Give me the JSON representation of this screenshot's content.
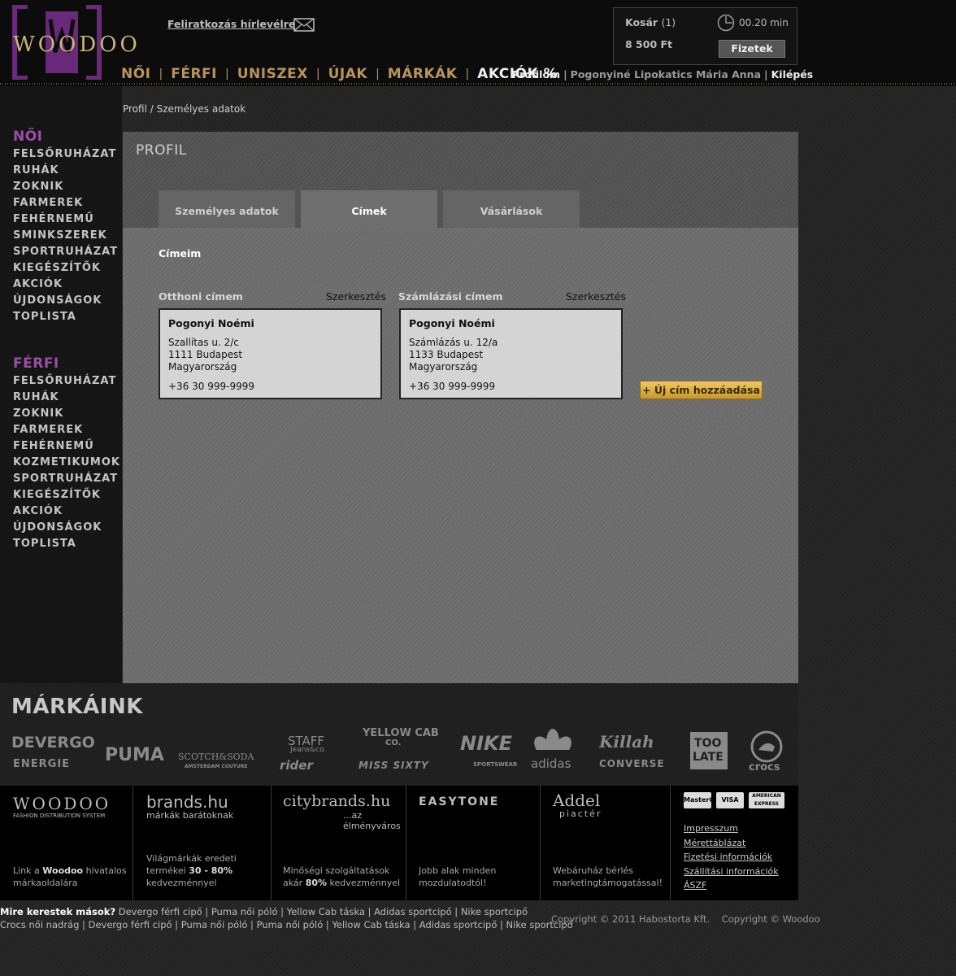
{
  "header": {
    "logo_text": "WOODOO",
    "newsletter": "Feliratkozás hírlevélre",
    "cart": {
      "title": "Kosár",
      "count": "(1)",
      "total": "8 500 Ft",
      "time": "00.20 min",
      "pay": "Fizetek"
    },
    "nav": [
      "NŐI",
      "FÉRFI",
      "UNISZEX",
      "ÚJAK",
      "MÁRKÁK",
      "AKCIÓK %"
    ],
    "user": {
      "profile": "Profilom",
      "name": "Pogonyiné Lipokatics Mária Anna",
      "logout": "Kilépés"
    }
  },
  "sidebar": {
    "women": {
      "title": "NŐI",
      "items": [
        "FELSŐRUHÁZAT",
        "RUHÁK",
        "ZOKNIK",
        "FARMEREK",
        "FEHÉRNEMŰ",
        "SMINKSZEREK",
        "SPORTRUHÁZAT",
        "KIEGÉSZÍTŐK",
        "AKCIÓK",
        "ÚJDONSÁGOK",
        "TOPLISTA"
      ]
    },
    "men": {
      "title": "FÉRFI",
      "items": [
        "FELSŐRUHÁZAT",
        "RUHÁK",
        "ZOKNIK",
        "FARMEREK",
        "FEHÉRNEMŰ",
        "KOZMETIKUMOK",
        "SPORTRUHÁZAT",
        "KIEGÉSZÍTŐK",
        "AKCIÓK",
        "ÚJDONSÁGOK",
        "TOPLISTA"
      ]
    }
  },
  "breadcrumb": "Profil / Személyes adatok",
  "profile": {
    "title": "PROFIL",
    "tabs": [
      "Személyes adatok",
      "Címek",
      "Vásárlások"
    ],
    "section": "Címeim",
    "home": {
      "label": "Otthoni címem",
      "edit": "Szerkesztés",
      "name": "Pogonyi Noémi",
      "street": "Szallítas u. 2/c",
      "city": "1111 Budapest",
      "country": "Magyarország",
      "phone": "+36 30 999-9999"
    },
    "billing": {
      "label": "Számlázási címem",
      "edit": "Szerkesztés",
      "name": "Pogonyi Noémi",
      "street": "Számlázás u. 12/a",
      "city": "1133 Budapest",
      "country": "Magyarország",
      "phone": "+36 30 999-9999"
    },
    "add_button": "+ Új cím hozzáadása"
  },
  "brands": {
    "title": "MÁRKÁINK",
    "logos": [
      "DEVERGO",
      "ENERGIE",
      "PUMA",
      "SCOTCH&SODA",
      "AMSTERDAM COUTURE",
      "STAFF",
      "Jeans&co.",
      "rider",
      "YELLOW CAB",
      "CO.",
      "MISS SIXTY",
      "NIKE",
      "SPORTSWEAR",
      "adidas",
      "Killah",
      "CONVERSE",
      "TOO",
      "LATE",
      "crocs"
    ]
  },
  "footer": {
    "woodoo": {
      "logo": "WOODOO",
      "sub": "FASHION DISTRIBUTION SYSTEM",
      "desc_pre": "Link a ",
      "desc_bold": "Woodoo",
      "desc_post": " hivatalos márkaoldalára"
    },
    "brandshu": {
      "logo": "brands.hu",
      "sub": "márkák barátoknak",
      "desc_pre": "Világmárkák eredeti termékei ",
      "desc_bold": "30 - 80%",
      "desc_post": " kedvezménnyel"
    },
    "citybrands": {
      "logo": "citybrands.hu",
      "sub": "...az élményváros",
      "desc_pre": "Minőségi szolgáltatások akár ",
      "desc_bold": "80%",
      "desc_post": " kedvezménnyel"
    },
    "easytone": {
      "logo": "EASYTONE",
      "desc": "Jobb alak minden mozdulatodtól!"
    },
    "addel": {
      "logo": "Addel",
      "sub": "piactér",
      "desc": "Webáruház bérlés marketingtámogatással!"
    },
    "cards": [
      "MasterCard",
      "VISA",
      "AMERICAN EXPRESS"
    ],
    "links": [
      "Impresszum",
      "Mérettáblázat",
      "Fizetési információk",
      "Szállítási információk",
      "ÁSZF"
    ]
  },
  "bottom": {
    "label": "Mire kerestek mások?",
    "row1": [
      "Devergo férfi cipő",
      "Puma női póló",
      "Yellow Cab táska",
      "Adidas sportcipő",
      "Nike sportcipő"
    ],
    "row2": [
      "Crocs női nadrág",
      "Devergo férfi cipő",
      "Puma női póló",
      "Puma női póló",
      "Yellow Cab táska",
      "Adidas sportcipő",
      "Nike sportcipő"
    ],
    "copyright": "Copyright © 2011 Habostorta Kft.    Copyright © Woodoo"
  }
}
